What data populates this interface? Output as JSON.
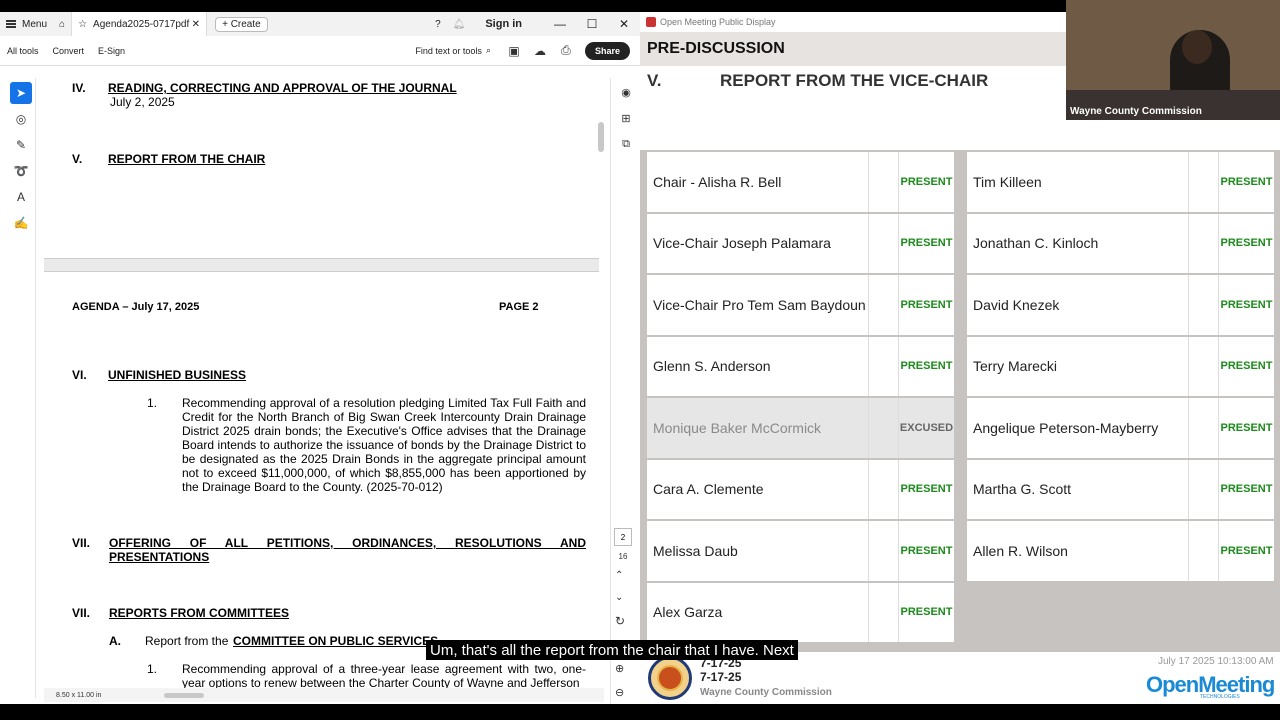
{
  "acrobat": {
    "menu_label": "Menu",
    "tab_title": "Agenda2025-0717pdf",
    "create_label": "Create",
    "sign_in_label": "Sign in",
    "tools": [
      "All tools",
      "Convert",
      "E-Sign"
    ],
    "find_placeholder": "Find text or tools",
    "share_label": "Share",
    "page_current": "2",
    "page_total": "16",
    "page_size": "8.50 x 11.00 in"
  },
  "document": {
    "sec4_num": "IV.",
    "sec4_title": "READING, CORRECTING AND APPROVAL OF THE JOURNAL",
    "sec4_date": "July 2, 2025",
    "sec5_num": "V.",
    "sec5_title": "REPORT FROM THE CHAIR",
    "header_left": "AGENDA – July 17, 2025",
    "header_right": "PAGE 2",
    "sec6_num": "VI.",
    "sec6_title": "UNFINISHED BUSINESS",
    "item1_num": "1.",
    "item1_text": "Recommending approval of a resolution pledging Limited Tax Full Faith and Credit for the North Branch of Big Swan Creek Intercounty Drain Drainage District 2025 drain bonds; the Executive's Office advises that the Drainage Board intends to authorize the issuance of bonds by the Drainage District to be designated as the 2025 Drain Bonds in the aggregate principal amount not to exceed $11,000,000, of which $8,855,000 has been apportioned by the Drainage Board to the County. (2025-70-012)",
    "sec7_num": "VII.",
    "sec7_title": "OFFERING OF ALL PETITIONS, ORDINANCES, RESOLUTIONS AND PRESENTATIONS",
    "sec7b_num": "VII.",
    "sec7b_title": "REPORTS FROM COMMITTEES",
    "subA_num": "A.",
    "subA_prefix": "Report from the ",
    "subA_committee": "COMMITTEE ON PUBLIC SERVICES",
    "subA_item_num": "1.",
    "subA_item_text": "Recommending approval of a three-year lease agreement with two, one-year options to renew between the Charter County of Wayne and Jefferson"
  },
  "openmeeting": {
    "window_title": "Open Meeting Public Display",
    "banner": "PRE-DISCUSSION",
    "section_num": "V.",
    "section_title": "REPORT FROM THE VICE-CHAIR",
    "left_members": [
      {
        "name": "Chair - Alisha R. Bell",
        "status": "PRESENT"
      },
      {
        "name": "Vice-Chair Joseph Palamara",
        "status": "PRESENT"
      },
      {
        "name": "Vice-Chair Pro Tem Sam Baydoun",
        "status": "PRESENT"
      },
      {
        "name": "Glenn S. Anderson",
        "status": "PRESENT"
      },
      {
        "name": "Monique Baker McCormick",
        "status": "EXCUSED"
      },
      {
        "name": "Cara A. Clemente",
        "status": "PRESENT"
      },
      {
        "name": "Melissa Daub",
        "status": "PRESENT"
      },
      {
        "name": "Alex Garza",
        "status": "PRESENT"
      }
    ],
    "right_members": [
      {
        "name": "Tim Killeen",
        "status": "PRESENT"
      },
      {
        "name": "Jonathan C. Kinloch",
        "status": "PRESENT"
      },
      {
        "name": "David Knezek",
        "status": "PRESENT"
      },
      {
        "name": "Terry Marecki",
        "status": "PRESENT"
      },
      {
        "name": "Angelique Peterson-Mayberry",
        "status": "PRESENT"
      },
      {
        "name": "Martha G. Scott",
        "status": "PRESENT"
      },
      {
        "name": "Allen R. Wilson",
        "status": "PRESENT"
      }
    ],
    "footer_date1": "7-17-25",
    "footer_date2": "7-17-25",
    "footer_commission": "Wayne County Commission",
    "footer_time": "July 17 2025 10:13:00 AM",
    "footer_logo": "OpenMeeting",
    "footer_logo_sub": "TECHNOLOGIES",
    "colors": {
      "present": "#1c8a1c",
      "excused": "#666666"
    }
  },
  "webcam": {
    "label": "Wayne County Commission"
  },
  "caption": "Um, that's all the report from the chair that I have. Next"
}
